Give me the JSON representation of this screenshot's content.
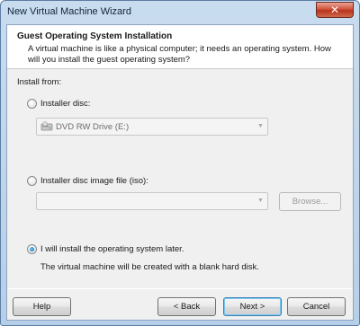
{
  "window": {
    "title": "New Virtual Machine Wizard",
    "close_glyph": "✕"
  },
  "header": {
    "title": "Guest Operating System Installation",
    "subtitle": "A virtual machine is like a physical computer; it needs an operating system. How will you install the guest operating system?"
  },
  "install_from": {
    "label": "Install from:",
    "options": [
      {
        "label": "Installer disc:",
        "selected": false
      },
      {
        "label": "Installer disc image file (iso):",
        "selected": false
      },
      {
        "label": "I will install the operating system later.",
        "selected": true
      }
    ],
    "disc_drive": {
      "value": "DVD RW Drive (E:)",
      "icon": "dvd-drive-icon"
    },
    "iso_path": {
      "value": "",
      "browse_label": "Browse..."
    },
    "later_note": "The virtual machine will be created with a blank hard disk."
  },
  "buttons": {
    "help": "Help",
    "back": "< Back",
    "next": "Next >",
    "cancel": "Cancel"
  }
}
